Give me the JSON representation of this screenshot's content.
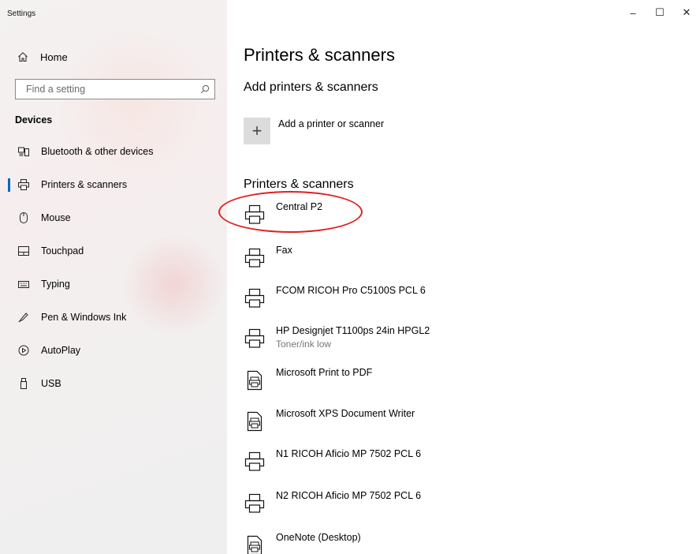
{
  "window": {
    "title": "Settings",
    "minimize_glyph": "–",
    "maximize_glyph": "☐",
    "close_glyph": "✕"
  },
  "sidebar": {
    "home_label": "Home",
    "search_placeholder": "Find a setting",
    "section_label": "Devices",
    "items": [
      {
        "label": "Bluetooth & other devices",
        "icon": "bluetooth-devices-icon"
      },
      {
        "label": "Printers & scanners",
        "icon": "printer-icon",
        "active": true
      },
      {
        "label": "Mouse",
        "icon": "mouse-icon"
      },
      {
        "label": "Touchpad",
        "icon": "touchpad-icon"
      },
      {
        "label": "Typing",
        "icon": "keyboard-icon"
      },
      {
        "label": "Pen & Windows Ink",
        "icon": "pen-icon"
      },
      {
        "label": "AutoPlay",
        "icon": "autoplay-icon"
      },
      {
        "label": "USB",
        "icon": "usb-icon"
      }
    ]
  },
  "main": {
    "title": "Printers & scanners",
    "add_section_title": "Add printers & scanners",
    "add_button_label": "Add a printer or scanner",
    "list_title": "Printers & scanners",
    "printers": [
      {
        "name": "Central P2",
        "status": "",
        "icon": "printer-icon"
      },
      {
        "name": "Fax",
        "status": "",
        "icon": "fax-printer-icon"
      },
      {
        "name": "FCOM RICOH Pro C5100S PCL 6",
        "status": "",
        "icon": "printer-icon"
      },
      {
        "name": "HP Designjet T1100ps 24in HPGL2",
        "status": "Toner/ink low",
        "icon": "printer-icon"
      },
      {
        "name": "Microsoft Print to PDF",
        "status": "",
        "icon": "pdf-printer-icon"
      },
      {
        "name": "Microsoft XPS Document Writer",
        "status": "",
        "icon": "document-printer-icon"
      },
      {
        "name": "N1 RICOH Aficio MP 7502 PCL 6",
        "status": "",
        "icon": "printer-icon"
      },
      {
        "name": "N2 RICOH Aficio MP 7502 PCL 6",
        "status": "",
        "icon": "printer-icon"
      },
      {
        "name": "OneNote (Desktop)",
        "status": "",
        "icon": "document-printer-icon"
      }
    ]
  },
  "colors": {
    "accent": "#0067c0",
    "annotation": "#e02020"
  }
}
